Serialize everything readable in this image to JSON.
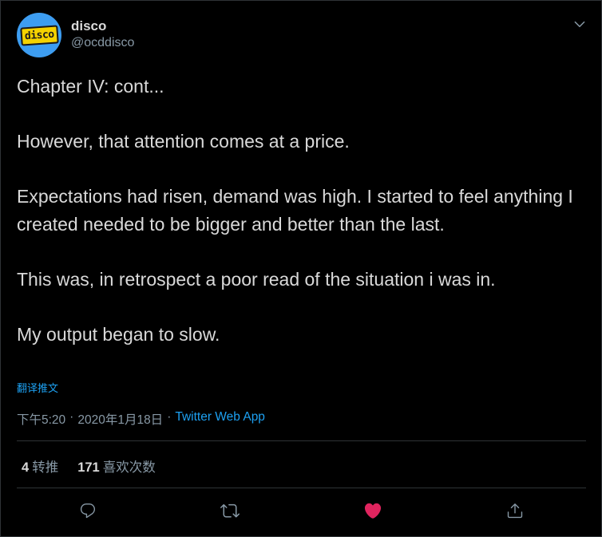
{
  "author": {
    "display_name": "disco",
    "handle": "@ocddisco",
    "avatar_text": "disco"
  },
  "tweet": {
    "paragraphs": [
      "Chapter IV: cont...",
      "However, that attention comes at a price.",
      "Expectations had risen, demand was high. I started to feel anything I created needed to be bigger and better than the last.",
      "This was, in retrospect a poor read of the situation i was in.",
      "My output began to slow."
    ],
    "translate_label": "翻译推文"
  },
  "meta": {
    "time": "下午5:20",
    "separator1": "·",
    "date": "2020年1月18日",
    "separator2": "·",
    "source": "Twitter Web App"
  },
  "stats": {
    "retweets_count": "4",
    "retweets_label": "转推",
    "likes_count": "171",
    "likes_label": "喜欢次数"
  },
  "actions": {
    "reply": "reply-icon",
    "retweet": "retweet-icon",
    "like": "heart-icon",
    "share": "share-icon"
  },
  "colors": {
    "background": "#000000",
    "text": "#d9d9d9",
    "secondary": "#8899a6",
    "accent": "#1da1f2",
    "like": "#e0245e",
    "divider": "#2f3336",
    "avatar_bg": "#3d9df1"
  }
}
